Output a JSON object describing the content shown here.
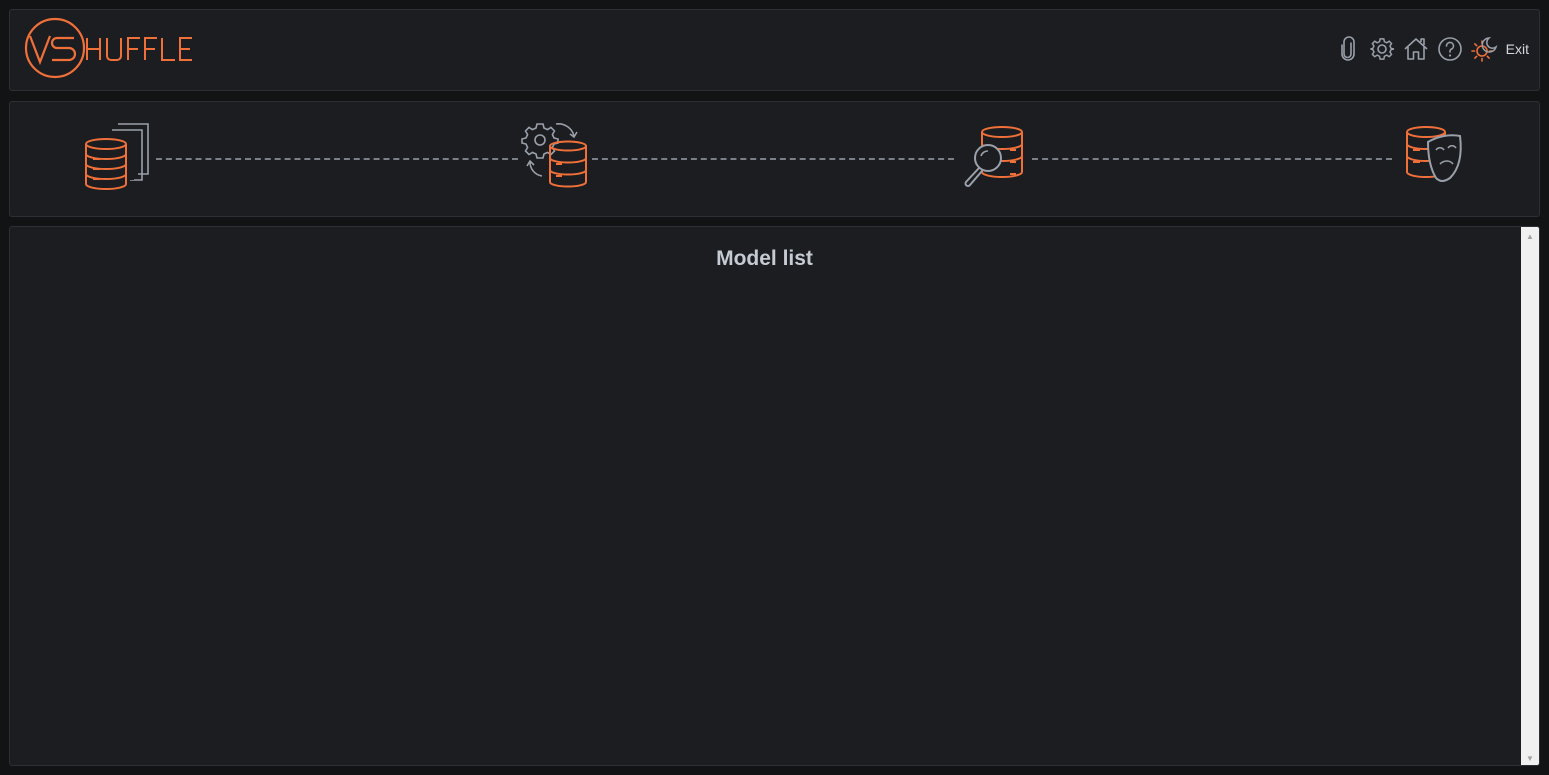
{
  "header": {
    "logo_text": "VSHUFFLE",
    "toolbar": {
      "icons": [
        "paperclip-icon",
        "gear-icon",
        "home-icon",
        "help-icon",
        "theme-toggle-icon"
      ],
      "exit_label": "Exit"
    }
  },
  "stepper": {
    "steps": [
      {
        "icon": "database-documents-icon"
      },
      {
        "icon": "database-settings-sync-icon"
      },
      {
        "icon": "database-search-icon"
      },
      {
        "icon": "database-mask-icon"
      }
    ]
  },
  "main": {
    "title": "Model list"
  },
  "colors": {
    "accent": "#f0703a",
    "panel": "#1c1d21",
    "background": "#121315",
    "icon_gray": "#9aa0aa"
  }
}
